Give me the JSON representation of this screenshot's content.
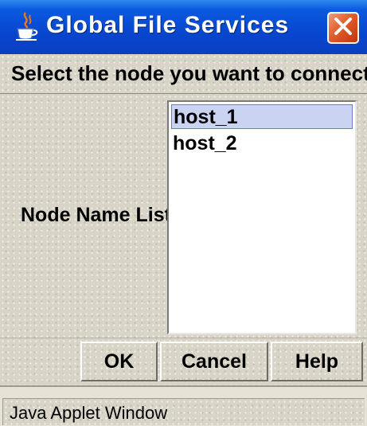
{
  "window": {
    "title": "Global File Services",
    "title_icon": "java-cup-icon",
    "close_icon": "close-icon"
  },
  "prompt": "Select the node you want to connect.",
  "node_list": {
    "label": "Node Name List:",
    "items": [
      {
        "label": "host_1",
        "selected": true
      },
      {
        "label": "host_2",
        "selected": false
      }
    ]
  },
  "buttons": {
    "ok": "OK",
    "cancel": "Cancel",
    "help": "Help"
  },
  "status": "Java Applet Window",
  "colors": {
    "titlebar": "#0846cf",
    "close_button": "#e15c2b",
    "panel": "#d8d4c8",
    "selection": "#cad3f2"
  }
}
